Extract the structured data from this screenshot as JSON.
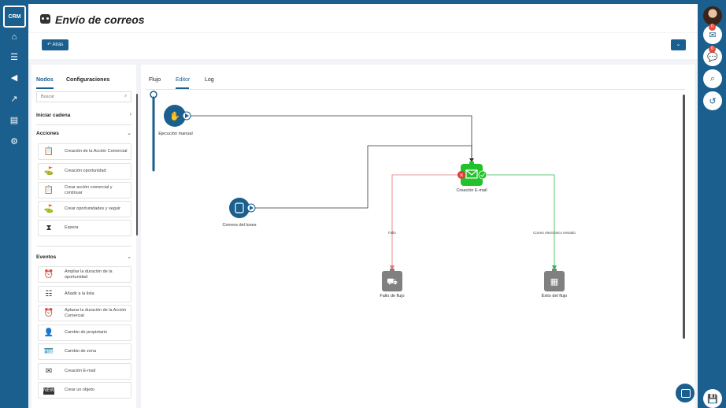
{
  "app": {
    "logo_text": "CRM"
  },
  "header": {
    "title": "Envío de correos",
    "back_label": "Atrás",
    "collapse_icon": "chevron-down-icon"
  },
  "left_nav": {
    "icons": [
      "home-icon",
      "list-icon",
      "megaphone-icon",
      "chart-icon",
      "document-icon",
      "gear-icon"
    ]
  },
  "right_rail": {
    "mail_badge": "0",
    "chat_badge": "0",
    "icons": [
      "mail-icon",
      "chat-icon",
      "search-icon",
      "history-icon",
      "save-icon"
    ]
  },
  "sidebar": {
    "tabs": [
      {
        "label": "Nodos"
      },
      {
        "label": "Configuraciones"
      }
    ],
    "search_placeholder": "Buscar",
    "start_chain": "Iniciar cadena",
    "actions_title": "Acciones",
    "actions": [
      {
        "label": "Creación de la Acción Comercial",
        "icon": "clipboard-check-icon"
      },
      {
        "label": "Creación oportunidad",
        "icon": "target-icon"
      },
      {
        "label": "Crear acción comercial y continuar",
        "icon": "clipboard-check-icon"
      },
      {
        "label": "Crear oportunidades y seguir",
        "icon": "target-icon"
      },
      {
        "label": "Espera",
        "icon": "hourglass-icon"
      }
    ],
    "events_title": "Eventos",
    "events": [
      {
        "label": "Ampliar la duración de la oportunidad",
        "icon": "alarm-plus-icon"
      },
      {
        "label": "Añadir a la lista",
        "icon": "list-icon"
      },
      {
        "label": "Aplazar la duración de la Acción Comercial",
        "icon": "alarm-plus-icon"
      },
      {
        "label": "Cambio de propietario",
        "icon": "user-icon"
      },
      {
        "label": "Cambio de zona",
        "icon": "id-card-icon"
      },
      {
        "label": "Creación E-mail",
        "icon": "envelope-icon"
      },
      {
        "label": "Crear un objeto",
        "icon": "new-badge-icon"
      }
    ]
  },
  "editor": {
    "tabs": [
      {
        "label": "Flujo"
      },
      {
        "label": "Editor"
      },
      {
        "label": "Log"
      }
    ],
    "nodes": {
      "manual": "Ejecución manual",
      "monday": "Correos del lunes",
      "email": "Creación E-mail",
      "fail": "Fallo de flujo",
      "success": "Éxito del flujo"
    },
    "edges": {
      "fail": "Fallo",
      "sent": "Correo electrónico enviado"
    },
    "colors": {
      "start": "#1a5f8e",
      "email": "#22c22b",
      "fail_edge": "#e57373",
      "success_edge": "#2fb84a",
      "end": "#808080"
    }
  }
}
